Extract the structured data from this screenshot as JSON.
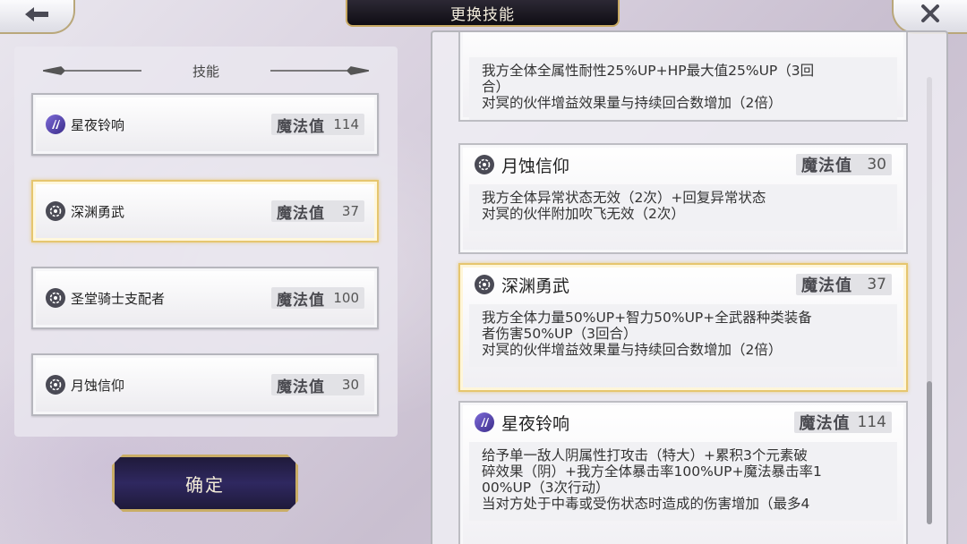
{
  "header": {
    "title": "更换技能"
  },
  "left_panel": {
    "title": "技能",
    "skills": [
      {
        "name": "星夜铃响",
        "mp_label": "魔法值",
        "mp": "114",
        "icon": "purple-moon-icon",
        "selected": false
      },
      {
        "name": "深渊勇武",
        "mp_label": "魔法值",
        "mp": "37",
        "icon": "dark-gear-icon",
        "selected": true
      },
      {
        "name": "圣堂骑士支配者",
        "mp_label": "魔法值",
        "mp": "100",
        "icon": "dark-gear-icon",
        "selected": false
      },
      {
        "name": "月蚀信仰",
        "mp_label": "魔法值",
        "mp": "30",
        "icon": "dark-gear-icon",
        "selected": false
      }
    ]
  },
  "confirm_label": "确定",
  "details": [
    {
      "name": "",
      "mp_label": "",
      "mp": "",
      "lines": [
        "我方全体全属性耐性25%UP+HP最大值25%UP（3回",
        "合）",
        "对冥的伙伴增益效果量与持续回合数增加（2倍）"
      ]
    },
    {
      "name": "月蚀信仰",
      "mp_label": "魔法值",
      "mp": "30",
      "lines": [
        "我方全体异常状态无效（2次）+回复异常状态",
        "对冥的伙伴附加吹飞无效（2次）"
      ]
    },
    {
      "name": "深渊勇武",
      "mp_label": "魔法值",
      "mp": "37",
      "lines": [
        "我方全体力量50%UP+智力50%UP+全武器种类装备",
        "者伤害50%UP（3回合）",
        "对冥的伙伴增益效果量与持续回合数增加（2倍）"
      ]
    },
    {
      "name": "星夜铃响",
      "mp_label": "魔法值",
      "mp": "114",
      "lines": [
        "给予单一敌人阴属性打攻击（特大）+累积3个元素破",
        "碎效果（阴）+我方全体暴击率100%UP+魔法暴击率1",
        "00%UP（3次行动）",
        "当对方处于中毒或受伤状态时造成的伤害增加（最多4"
      ]
    }
  ]
}
